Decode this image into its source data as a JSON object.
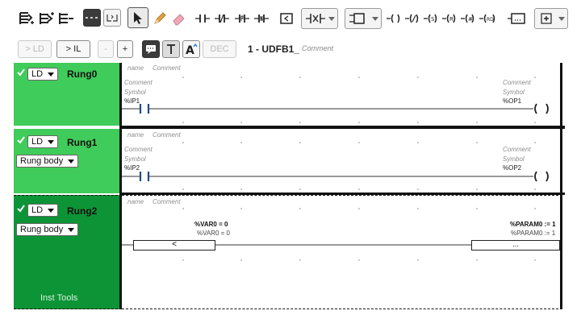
{
  "toolbar": {
    "row2": {
      "to_ld": "> LD",
      "to_il": "> IL",
      "minus": "-",
      "plus": "+",
      "dec": "DEC"
    },
    "program_title": "1 - UDFB1_",
    "program_comment": "Comment"
  },
  "rungs": [
    {
      "lang": "LD",
      "name": "Rung0",
      "header_name": "name",
      "header_comment": "Comment",
      "contact": {
        "comment": "Comment",
        "symbol": "Symbol",
        "address": "%IP1"
      },
      "coil": {
        "comment": "Comment",
        "symbol": "Symbol",
        "address": "%OP1"
      }
    },
    {
      "lang": "LD",
      "name": "Rung1",
      "body_label": "Rung body",
      "header_name": "name",
      "header_comment": "Comment",
      "contact": {
        "comment": "Comment",
        "symbol": "Symbol",
        "address": "%IP2"
      },
      "coil": {
        "comment": "Comment",
        "symbol": "Symbol",
        "address": "%OP2"
      }
    },
    {
      "lang": "LD",
      "name": "Rung2",
      "body_label": "Rung body",
      "header_name": "name",
      "header_comment": "Comment",
      "compare": {
        "expr_bold": "%VAR0 = 0",
        "expr": "%VAR0 = 0",
        "symbol": "<"
      },
      "operate": {
        "expr_bold": "%PARAM0 := 1",
        "expr": "%PARAM0 := 1",
        "symbol": "..."
      },
      "footer": "Inst Tools"
    }
  ],
  "colors": {
    "rung_light": "#3fcc5a",
    "rung_dark": "#0c9436",
    "rail": "#111111"
  }
}
